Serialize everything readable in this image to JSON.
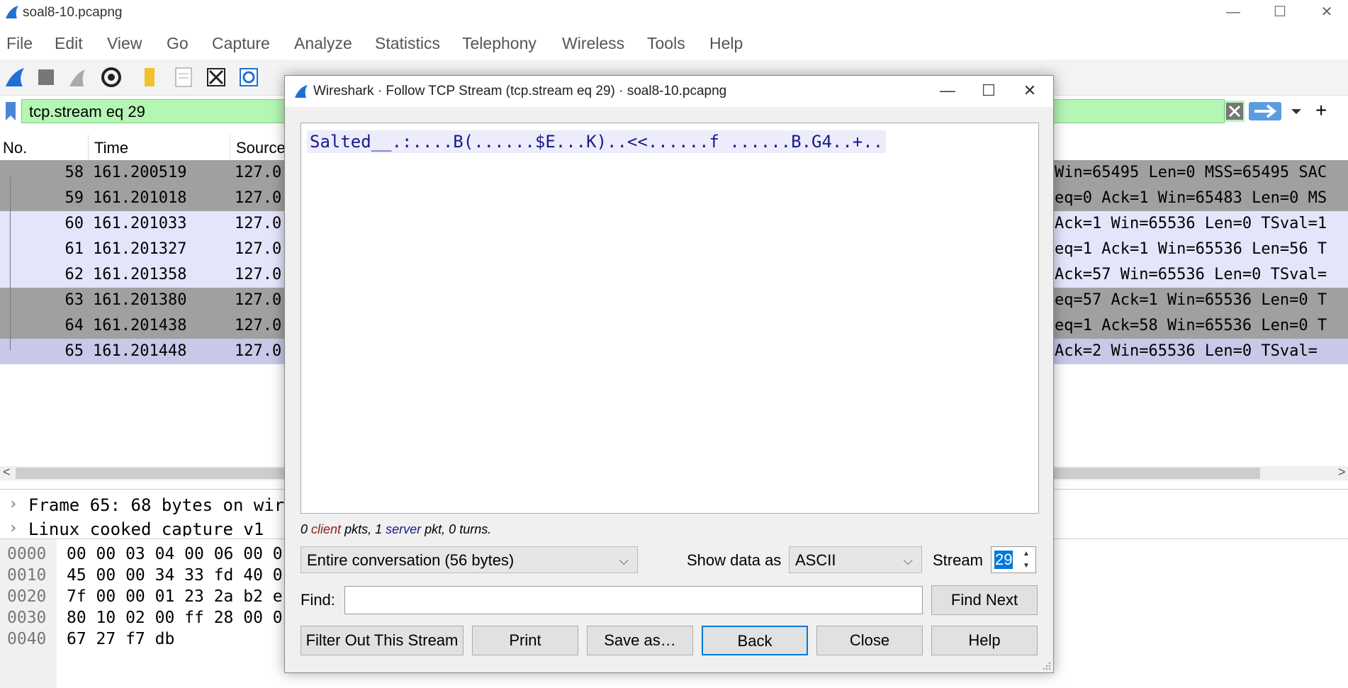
{
  "window": {
    "title": "soal8-10.pcapng",
    "minimize": "—",
    "maximize": "☐",
    "close": "✕"
  },
  "menu": [
    "File",
    "Edit",
    "View",
    "Go",
    "Capture",
    "Analyze",
    "Statistics",
    "Telephony",
    "Wireless",
    "Tools",
    "Help"
  ],
  "filter": {
    "value": "tcp.stream eq 29",
    "add": "+"
  },
  "packet_list": {
    "columns": [
      "No.",
      "Time",
      "Source"
    ],
    "rows": [
      {
        "no": "58",
        "time": "161.200519",
        "src": "127.0",
        "info": "Win=65495 Len=0 MSS=65495 SAC",
        "style": "dark"
      },
      {
        "no": "59",
        "time": "161.201018",
        "src": "127.0",
        "info": "eq=0 Ack=1 Win=65483 Len=0 MS",
        "style": "dark"
      },
      {
        "no": "60",
        "time": "161.201033",
        "src": "127.0",
        "info": "Ack=1 Win=65536 Len=0 TSval=1",
        "style": "light"
      },
      {
        "no": "61",
        "time": "161.201327",
        "src": "127.0",
        "info": "eq=1 Ack=1 Win=65536 Len=56 T",
        "style": "light"
      },
      {
        "no": "62",
        "time": "161.201358",
        "src": "127.0",
        "info": "Ack=57 Win=65536 Len=0 TSval=",
        "style": "light"
      },
      {
        "no": "63",
        "time": "161.201380",
        "src": "127.0",
        "info": "eq=57 Ack=1 Win=65536 Len=0 T",
        "style": "dark"
      },
      {
        "no": "64",
        "time": "161.201438",
        "src": "127.0",
        "info": "eq=1 Ack=58 Win=65536 Len=0 T",
        "style": "dark"
      },
      {
        "no": "65",
        "time": "161.201448",
        "src": "127.0",
        "info": "Ack=2 Win=65536 Len=0 TSval=",
        "style": "sel"
      }
    ]
  },
  "details": {
    "line1": "Frame 65: 68 bytes on wir",
    "line2": "Linux cooked capture v1"
  },
  "bytes": [
    {
      "off": "0000",
      "hex": "00 00 03 04 00 06 00 0"
    },
    {
      "off": "0010",
      "hex": "45 00 00 34 33 fd 40 0"
    },
    {
      "off": "0020",
      "hex": "7f 00 00 01 23 2a b2 e"
    },
    {
      "off": "0030",
      "hex": "80 10 02 00 ff 28 00 0"
    },
    {
      "off": "0040",
      "hex": "67 27 f7 db"
    }
  ],
  "dialog": {
    "title": "Wireshark · Follow TCP Stream (tcp.stream eq 29) · soal8-10.pcapng",
    "stream_text": "Salted__.:....B(......$E...K)..<<......f ......B.G4..+..",
    "stats": {
      "client_count": "0",
      "client_word": "client",
      "pkts_word": "pkts,",
      "server_count": "1",
      "server_word": "server",
      "tail": "pkt, 0 turns."
    },
    "conversation": "Entire conversation (56 bytes)",
    "show_data_label": "Show data as",
    "show_data_value": "ASCII",
    "stream_label": "Stream",
    "stream_value": "29",
    "find_label": "Find:",
    "find_value": "",
    "buttons": {
      "find_next": "Find Next",
      "filter_out": "Filter Out This Stream",
      "print": "Print",
      "save_as": "Save as…",
      "back": "Back",
      "close": "Close",
      "help": "Help"
    }
  },
  "colors": {
    "filter_bg": "#b4f6b4",
    "row_dark": "#a0a0a0",
    "row_light": "#e4e4fb",
    "accent": "#0078d7"
  }
}
